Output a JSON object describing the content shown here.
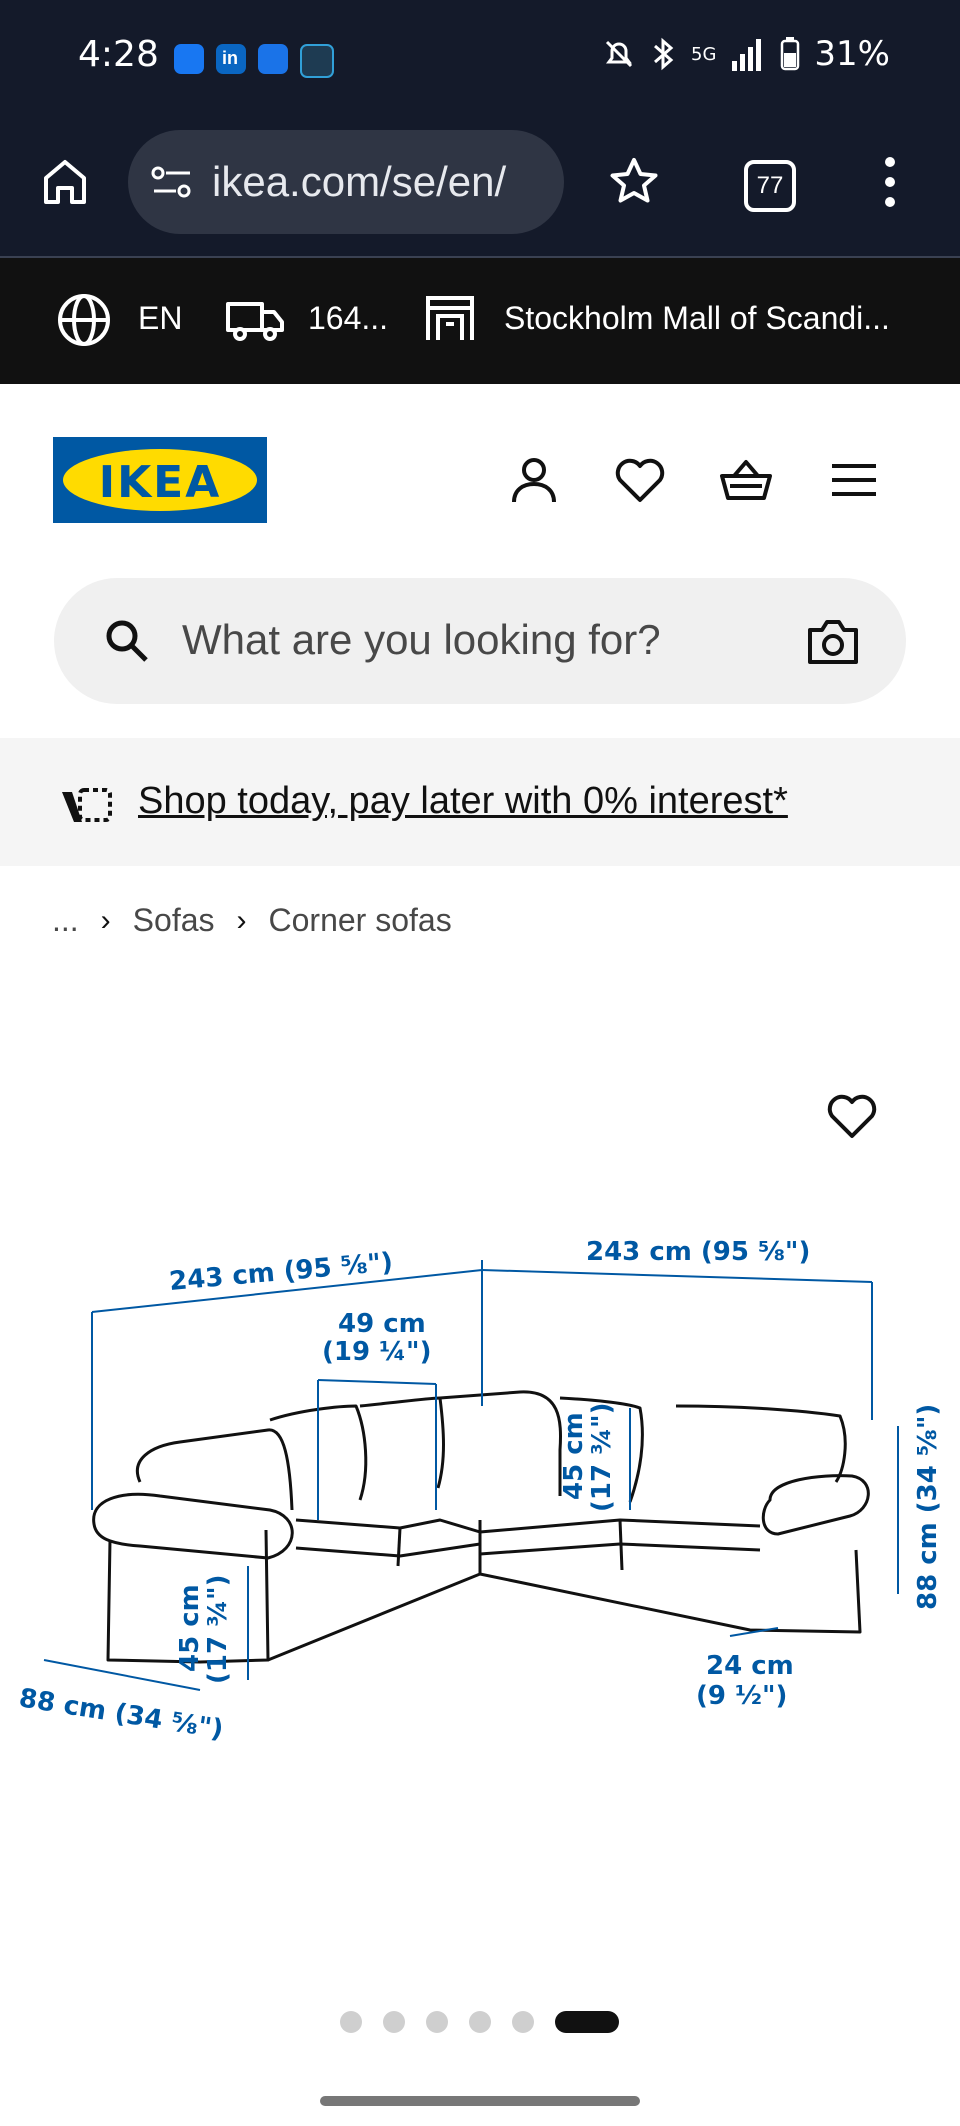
{
  "status_bar": {
    "time": "4:28",
    "network": "5G",
    "battery": "31%",
    "icons": [
      "messenger-icon",
      "linkedin-icon",
      "wifi-app-icon",
      "app-icon",
      "mute-icon",
      "bluetooth-icon",
      "signal-icon",
      "battery-icon"
    ]
  },
  "browser": {
    "url": "ikea.com/se/en/",
    "tab_count": "77",
    "icons": [
      "home-icon",
      "site-settings-icon",
      "star-icon",
      "menu-dots-icon"
    ]
  },
  "ikea_strip": {
    "language": "EN",
    "delivery": "164...",
    "store": "Stockholm Mall of Scandi..."
  },
  "header": {
    "logo_text": "IKEA",
    "icons": [
      "account-icon",
      "heart-icon",
      "cart-icon",
      "hamburger-icon"
    ]
  },
  "search": {
    "placeholder": "What are you looking for?"
  },
  "banner": {
    "text": "Shop today, pay later with 0% interest*"
  },
  "breadcrumb": {
    "ellipsis": "...",
    "items": [
      "Sofas",
      "Corner sofas"
    ]
  },
  "product_image": {
    "dimensions": {
      "width_left": "243 cm (95 ⅝\")",
      "width_right": "243 cm (95 ⅝\")",
      "seat_width_cm": "49 cm",
      "seat_width_in": "(19 ¼\")",
      "seat_height_cm": "45 cm",
      "seat_height_in": "(17 ¾\")",
      "back_height_cm": "45 cm",
      "back_height_in": "(17 ¾\")",
      "depth_left": "88 cm (34 ⅝\")",
      "depth_right": "88 cm (34 ⅝\")",
      "arm_cm": "24 cm",
      "arm_in": "(9 ½\")"
    }
  },
  "carousel": {
    "count": 6,
    "active_index": 5
  },
  "colors": {
    "ikea_blue": "#0058a3",
    "ikea_yellow": "#ffdb00",
    "chrome_dark": "#141a2a"
  }
}
